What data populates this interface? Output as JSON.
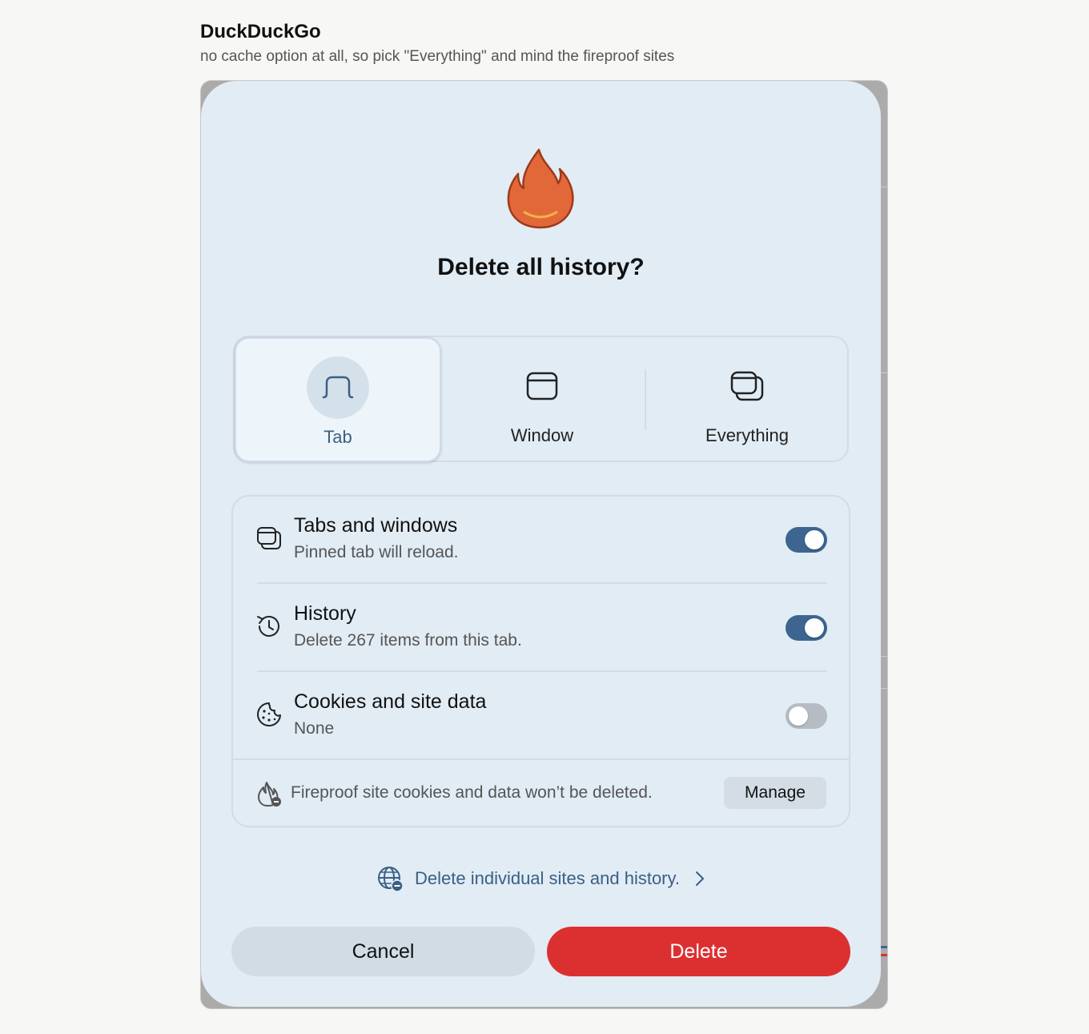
{
  "page": {
    "title": "DuckDuckGo",
    "subtitle": "no cache option at all, so pick \"Everything\" and mind the fireproof sites"
  },
  "dialog": {
    "title": "Delete all history?",
    "icon": "fire-icon",
    "scope": {
      "selected": "Tab",
      "options": [
        {
          "label": "Tab",
          "icon": "tab-icon"
        },
        {
          "label": "Window",
          "icon": "window-icon"
        },
        {
          "label": "Everything",
          "icon": "everything-icon"
        }
      ]
    },
    "options": [
      {
        "title": "Tabs and windows",
        "subtitle": "Pinned tab will reload.",
        "icon": "tabs-windows-icon",
        "enabled": true
      },
      {
        "title": "History",
        "subtitle": "Delete 267 items from this tab.",
        "icon": "history-icon",
        "enabled": true
      },
      {
        "title": "Cookies and site data",
        "subtitle": "None",
        "icon": "cookie-icon",
        "enabled": false
      }
    ],
    "fireproof": {
      "text": "Fireproof site cookies and data won’t be deleted.",
      "manage_label": "Manage",
      "icon": "fireproof-icon"
    },
    "individual_link": {
      "text": "Delete individual sites and history.",
      "icon": "globe-minus-icon"
    },
    "cancel_label": "Cancel",
    "delete_label": "Delete"
  },
  "colors": {
    "dialog_bg": "#e1ecf5",
    "accent": "#3c6590",
    "delete": "#dc3030",
    "fire": "#e2683a"
  }
}
